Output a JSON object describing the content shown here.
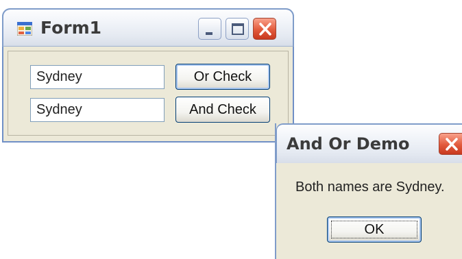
{
  "form1": {
    "title": "Form1",
    "icon": "form-app-icon",
    "textbox1_value": "Sydney",
    "textbox2_value": "Sydney",
    "or_button_label": "Or Check",
    "and_button_label": "And Check",
    "caption_buttons": [
      "minimize-icon",
      "maximize-icon",
      "close-icon"
    ]
  },
  "message_box": {
    "title": "And Or Demo",
    "message": "Both names are Sydney.",
    "ok_label": "OK",
    "close_icon": "close-icon"
  },
  "colors": {
    "window_body": "#ece9d8",
    "title_gradient_top": "#fdfdfe",
    "title_gradient_bottom": "#d8dee9",
    "close_button_red": "#e25a3c",
    "button_border": "#003c74",
    "textbox_border": "#7f9db9"
  }
}
